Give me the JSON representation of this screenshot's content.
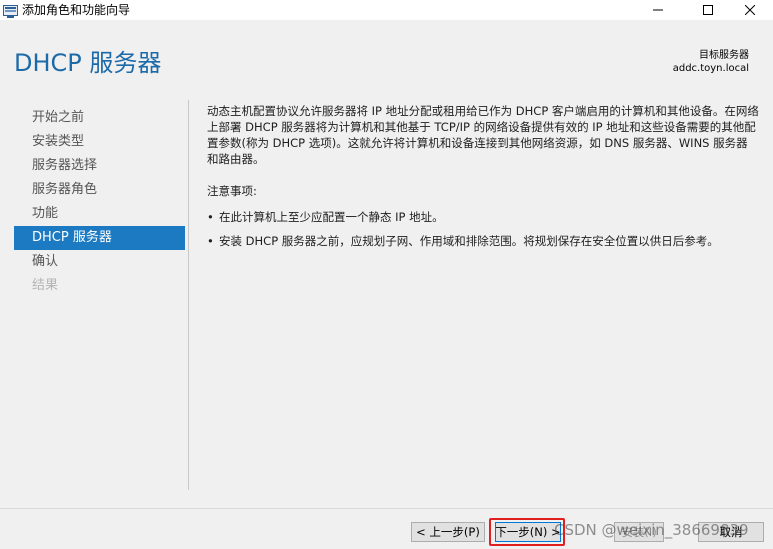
{
  "window": {
    "title": "添加角色和功能向导",
    "controls": [
      "minimize",
      "maximize",
      "close"
    ]
  },
  "header": {
    "page_title": "DHCP 服务器",
    "target_label": "目标服务器",
    "target_value": "addc.toyn.local"
  },
  "nav": {
    "items": [
      {
        "label": "开始之前",
        "state": "normal"
      },
      {
        "label": "安装类型",
        "state": "normal"
      },
      {
        "label": "服务器选择",
        "state": "normal"
      },
      {
        "label": "服务器角色",
        "state": "normal"
      },
      {
        "label": "功能",
        "state": "normal"
      },
      {
        "label": "DHCP 服务器",
        "state": "active"
      },
      {
        "label": "确认",
        "state": "normal"
      },
      {
        "label": "结果",
        "state": "disabled"
      }
    ]
  },
  "main": {
    "description": "动态主机配置协议允许服务器将 IP 地址分配或租用给已作为 DHCP 客户端启用的计算机和其他设备。在网络上部署 DHCP 服务器将为计算机和其他基于 TCP/IP 的网络设备提供有效的 IP 地址和这些设备需要的其他配置参数(称为 DHCP 选项)。这就允许将计算机和设备连接到其他网络资源，如 DNS 服务器、WINS 服务器和路由器。",
    "notes_label": "注意事项:",
    "bullet_char": "•",
    "notes": [
      "在此计算机上至少应配置一个静态 IP 地址。",
      "安装 DHCP 服务器之前，应规划子网、作用域和排除范围。将规划保存在安全位置以供日后参考。"
    ]
  },
  "footer": {
    "prev_label": "< 上一步(P)",
    "next_label": "下一步(N) >",
    "install_label": "安装(I)",
    "cancel_label": "取消"
  },
  "overlay": {
    "watermark": "CSDN @weixin_38669839",
    "highlight_color": "#e02020"
  },
  "colors": {
    "accent": "#1c7ac2",
    "title_blue": "#1d6aa8",
    "panel_bg": "#f0f0f0"
  }
}
